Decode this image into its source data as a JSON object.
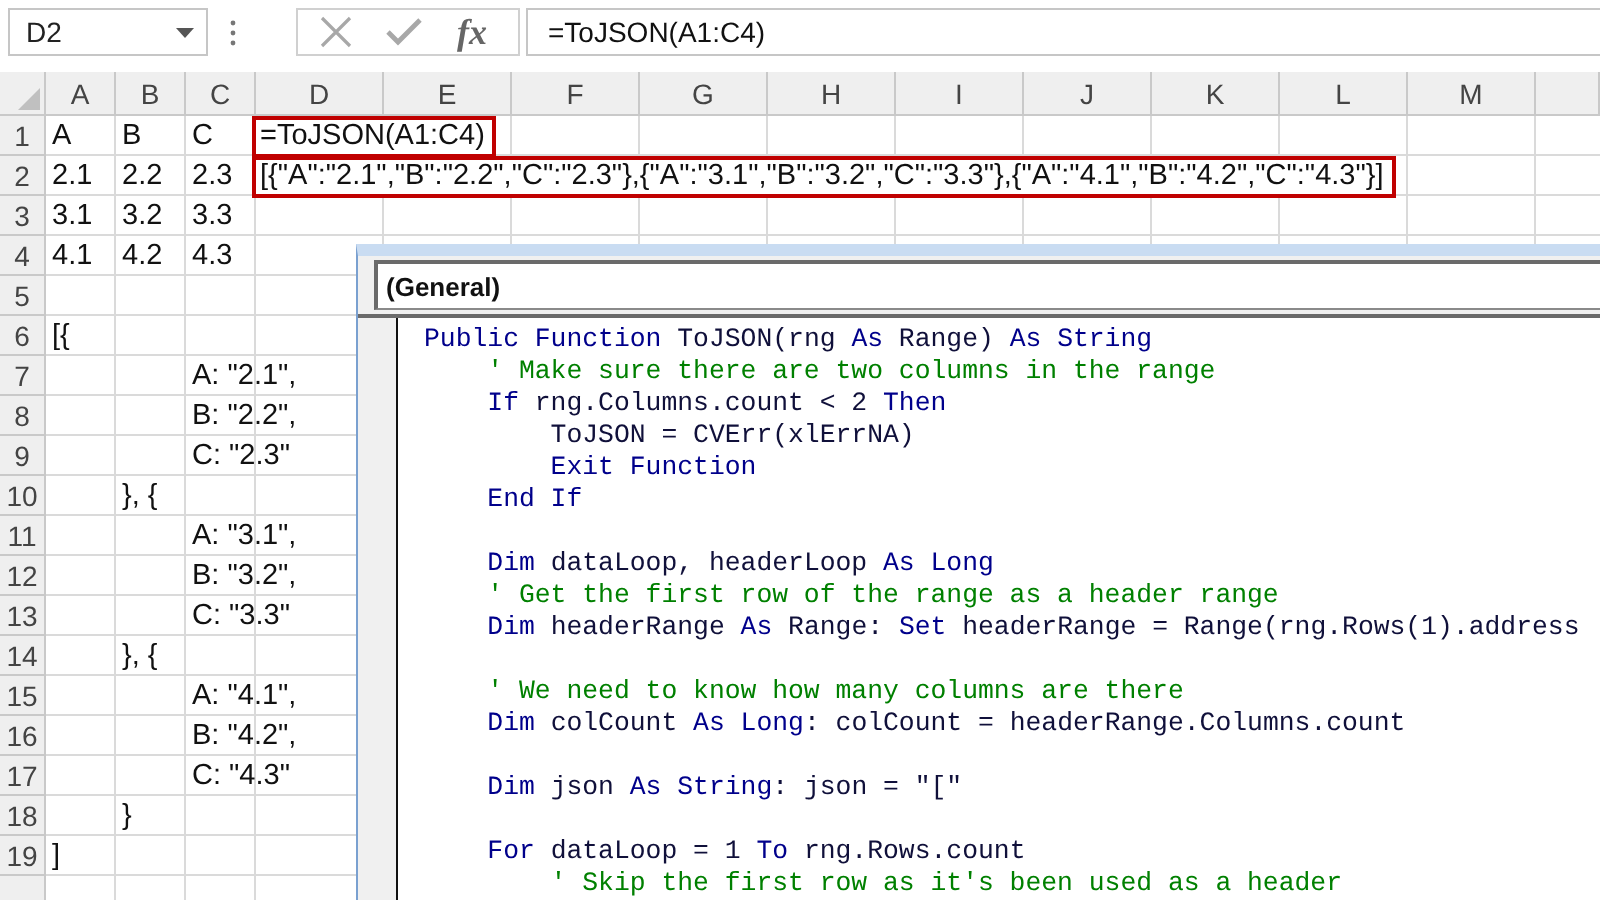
{
  "formula_bar": {
    "name_box": "D2",
    "function_button": "fx",
    "formula": "=ToJSON(A1:C4)"
  },
  "sheet": {
    "columns": [
      "A",
      "B",
      "C",
      "D",
      "E",
      "F",
      "G",
      "H",
      "I",
      "J",
      "K",
      "L",
      "M"
    ],
    "rows": [
      {
        "number": "1",
        "col_a": "A",
        "col_b": "B",
        "col_c": "C",
        "col_d": {
          "text": "=ToJSON(A1:C4)",
          "outlined": true
        }
      },
      {
        "number": "2",
        "col_a": "2.1",
        "col_b": "2.2",
        "col_c": "2.3",
        "col_d": {
          "text": "[{\"A\":\"2.1\",\"B\":\"2.2\",\"C\":\"2.3\"},{\"A\":\"3.1\",\"B\":\"3.2\",\"C\":\"3.3\"},{\"A\":\"4.1\",\"B\":\"4.2\",\"C\":\"4.3\"}]",
          "outlined": true
        }
      },
      {
        "number": "3",
        "col_a": "3.1",
        "col_b": "3.2",
        "col_c": "3.3"
      },
      {
        "number": "4",
        "col_a": "4.1",
        "col_b": "4.2",
        "col_c": "4.3"
      },
      {
        "number": "5"
      },
      {
        "number": "6",
        "col_a": "[{"
      },
      {
        "number": "7",
        "col_c": "A: \"2.1\","
      },
      {
        "number": "8",
        "col_c": "B: \"2.2\","
      },
      {
        "number": "9",
        "col_c": "C: \"2.3\""
      },
      {
        "number": "10",
        "col_b": "}, {"
      },
      {
        "number": "11",
        "col_c": "A: \"3.1\","
      },
      {
        "number": "12",
        "col_c": "B: \"3.2\","
      },
      {
        "number": "13",
        "col_c": "C: \"3.3\""
      },
      {
        "number": "14",
        "col_b": "}, {"
      },
      {
        "number": "15",
        "col_c": "A: \"4.1\","
      },
      {
        "number": "16",
        "col_c": "B: \"4.2\","
      },
      {
        "number": "17",
        "col_c": "C: \"4.3\""
      },
      {
        "number": "18",
        "col_b": "}"
      },
      {
        "number": "19",
        "col_a": "]"
      }
    ]
  },
  "vba_editor": {
    "object_dropdown": "(General)",
    "code_lines": [
      {
        "kind": "code",
        "segments": [
          {
            "kind": "keyword",
            "text": "Public Function"
          },
          {
            "kind": "plain",
            "text": " ToJSON(rng "
          },
          {
            "kind": "keyword",
            "text": "As"
          },
          {
            "kind": "plain",
            "text": " Range) "
          },
          {
            "kind": "keyword",
            "text": "As String"
          }
        ]
      },
      {
        "kind": "code",
        "segments": [
          {
            "kind": "comment",
            "text": "    ' Make sure there are two columns in the range"
          }
        ]
      },
      {
        "kind": "code",
        "segments": [
          {
            "kind": "keyword",
            "text": "    If"
          },
          {
            "kind": "plain",
            "text": " rng.Columns.count < 2 "
          },
          {
            "kind": "keyword",
            "text": "Then"
          }
        ]
      },
      {
        "kind": "code",
        "segments": [
          {
            "kind": "plain",
            "text": "        ToJSON = CVErr(xlErrNA)"
          }
        ]
      },
      {
        "kind": "code",
        "segments": [
          {
            "kind": "keyword",
            "text": "        Exit Function"
          }
        ]
      },
      {
        "kind": "code",
        "segments": [
          {
            "kind": "keyword",
            "text": "    End If"
          }
        ]
      },
      {
        "kind": "blank"
      },
      {
        "kind": "code",
        "segments": [
          {
            "kind": "keyword",
            "text": "    Dim"
          },
          {
            "kind": "plain",
            "text": " dataLoop, headerLoop "
          },
          {
            "kind": "keyword",
            "text": "As Long"
          }
        ]
      },
      {
        "kind": "code",
        "segments": [
          {
            "kind": "comment",
            "text": "    ' Get the first row of the range as a header range"
          }
        ]
      },
      {
        "kind": "code",
        "segments": [
          {
            "kind": "keyword",
            "text": "    Dim"
          },
          {
            "kind": "plain",
            "text": " headerRange "
          },
          {
            "kind": "keyword",
            "text": "As"
          },
          {
            "kind": "plain",
            "text": " Range: "
          },
          {
            "kind": "keyword",
            "text": "Set"
          },
          {
            "kind": "plain",
            "text": " headerRange = Range(rng.Rows(1).address"
          }
        ]
      },
      {
        "kind": "blank"
      },
      {
        "kind": "code",
        "segments": [
          {
            "kind": "comment",
            "text": "    ' We need to know how many columns are there"
          }
        ]
      },
      {
        "kind": "code",
        "segments": [
          {
            "kind": "keyword",
            "text": "    Dim"
          },
          {
            "kind": "plain",
            "text": " colCount "
          },
          {
            "kind": "keyword",
            "text": "As Long"
          },
          {
            "kind": "plain",
            "text": ": colCount = headerRange.Columns.count"
          }
        ]
      },
      {
        "kind": "blank"
      },
      {
        "kind": "code",
        "segments": [
          {
            "kind": "keyword",
            "text": "    Dim"
          },
          {
            "kind": "plain",
            "text": " json "
          },
          {
            "kind": "keyword",
            "text": "As String"
          },
          {
            "kind": "plain",
            "text": ": json = \"[\""
          }
        ]
      },
      {
        "kind": "blank"
      },
      {
        "kind": "code",
        "segments": [
          {
            "kind": "keyword",
            "text": "    For"
          },
          {
            "kind": "plain",
            "text": " dataLoop = 1 "
          },
          {
            "kind": "keyword",
            "text": "To"
          },
          {
            "kind": "plain",
            "text": " rng.Rows.count"
          }
        ]
      },
      {
        "kind": "code",
        "segments": [
          {
            "kind": "comment",
            "text": "        ' Skip the first row as it's been used as a header"
          }
        ]
      }
    ]
  }
}
